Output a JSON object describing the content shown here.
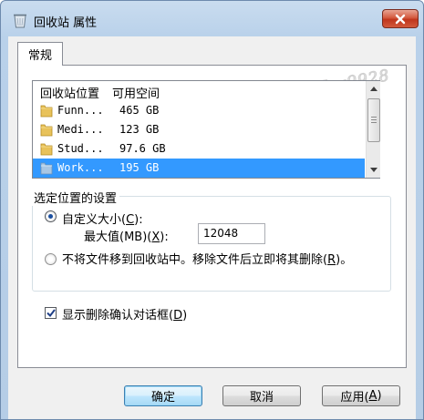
{
  "window": {
    "title": "回收站 属性"
  },
  "tabs": [
    {
      "label": "常规"
    }
  ],
  "watermark": "百度经验 By Key9928",
  "list": {
    "headers": [
      "回收站位置",
      "可用空间"
    ],
    "rows": [
      {
        "name": "Funn...",
        "space": "465 GB",
        "selected": false
      },
      {
        "name": "Medi...",
        "space": "123 GB",
        "selected": false
      },
      {
        "name": "Stud...",
        "space": "97.6 GB",
        "selected": false
      },
      {
        "name": "Work...",
        "space": "195 GB",
        "selected": true
      }
    ]
  },
  "settings": {
    "group_title": "选定位置的设置",
    "custom_size_label": "自定义大小(",
    "custom_size_key": "C",
    "custom_size_suffix": "):",
    "max_label": "最大值(MB)(",
    "max_key": "X",
    "max_suffix": "):",
    "max_value": "12048",
    "no_move_label": "不将文件移到回收站中。移除文件后立即将其删除(",
    "no_move_key": "R",
    "no_move_suffix": ")。",
    "custom_selected": true
  },
  "confirm": {
    "label": "显示删除确认对话框(",
    "key": "D",
    "suffix": ")",
    "checked": true
  },
  "buttons": {
    "ok": "确定",
    "cancel": "取消",
    "apply_label": "应用(",
    "apply_key": "A",
    "apply_suffix": ")"
  },
  "colors": {
    "selection": "#3399ff",
    "close_button": "#c0361c",
    "title_bar": "#b9d1ea"
  },
  "icons": {
    "title": "recycle-bin-icon",
    "close": "close-icon",
    "folder": "folder-icon",
    "scroll_up": "chevron-up-icon",
    "scroll_down": "chevron-down-icon",
    "check": "checkmark-icon"
  }
}
